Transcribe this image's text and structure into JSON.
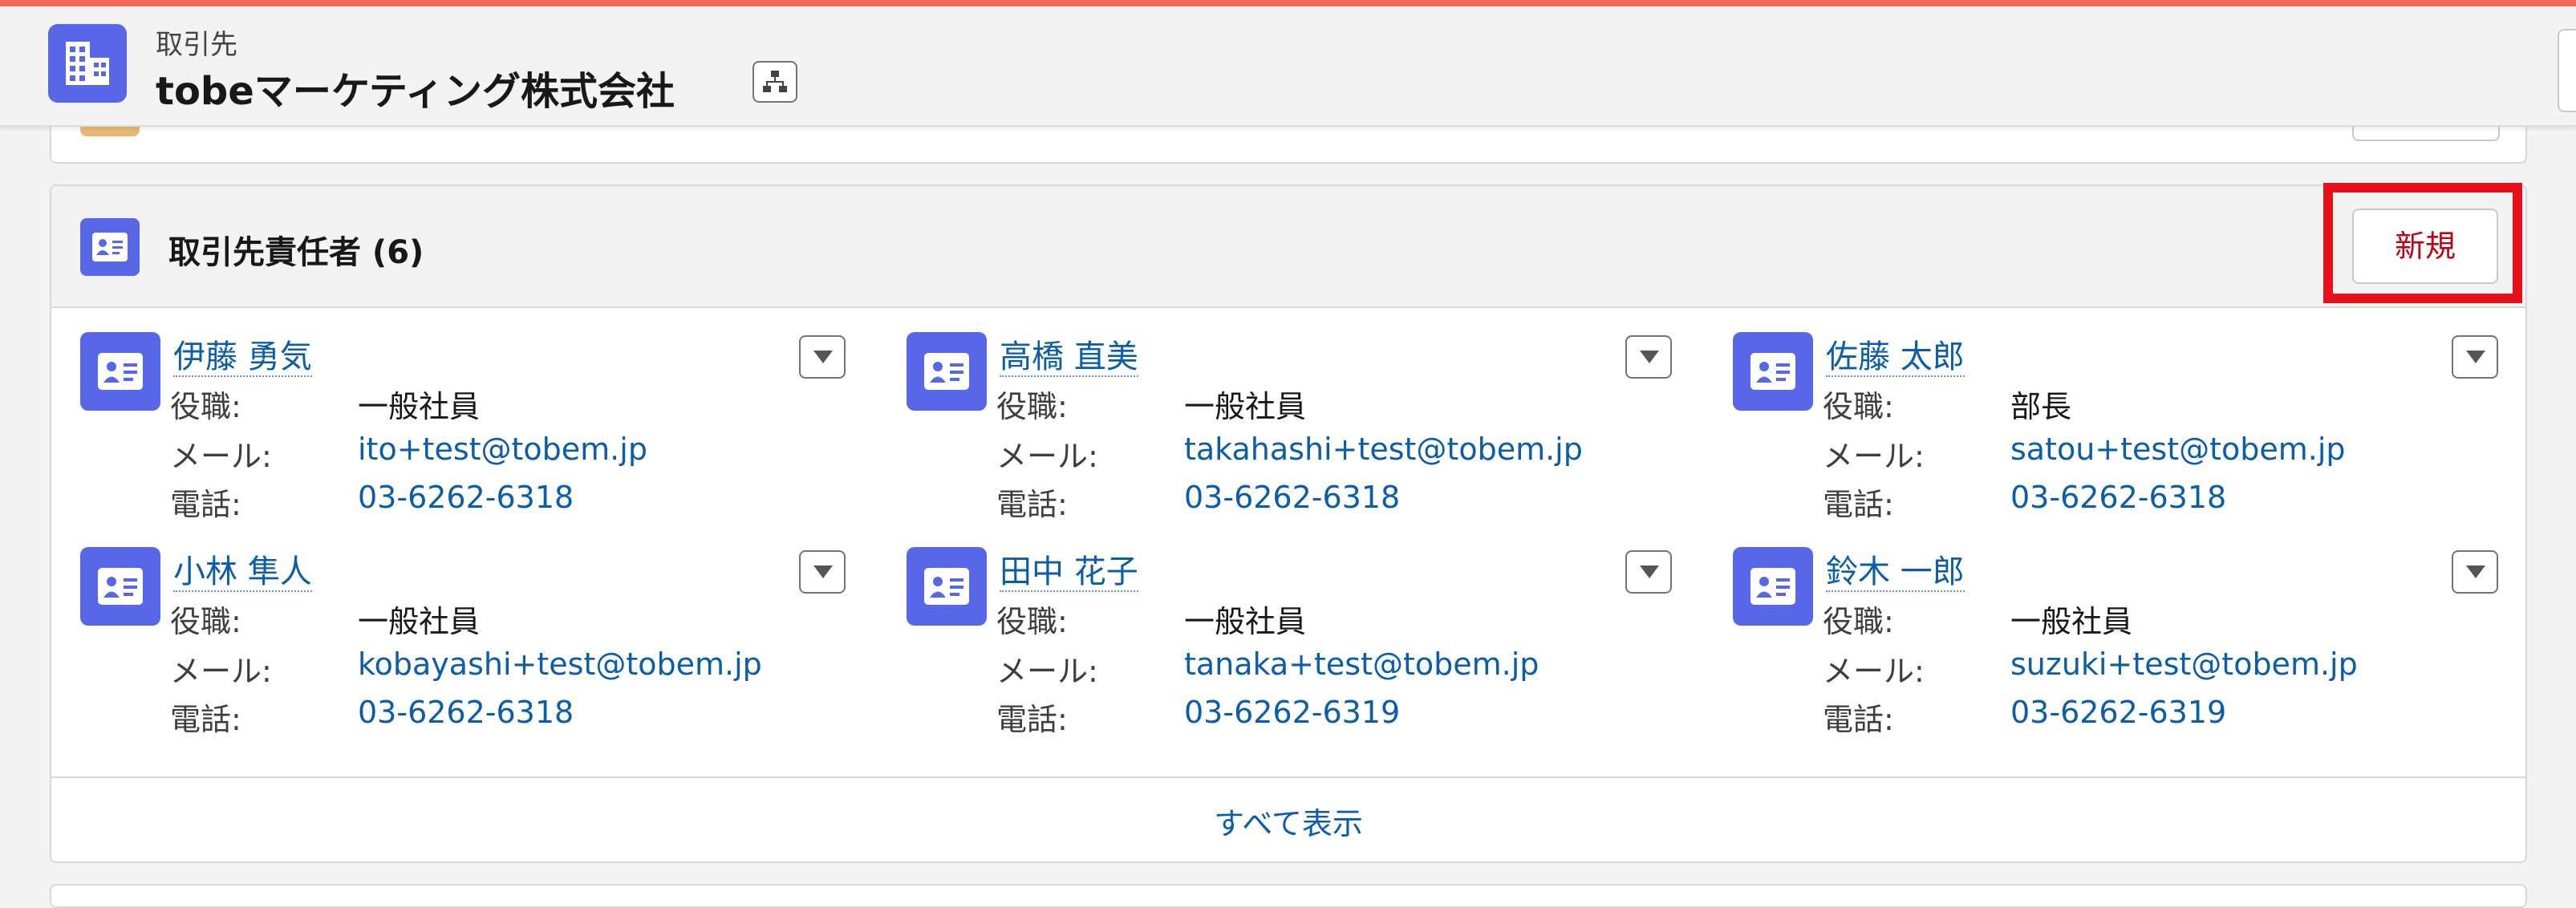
{
  "header": {
    "object_type": "取引先",
    "record_name": "tobeマーケティング株式会社"
  },
  "contacts_card": {
    "title": "取引先責任者 (6)",
    "new_button": "新規",
    "view_all": "すべて表示",
    "labels": {
      "role": "役職:",
      "email": "メール:",
      "phone": "電話:"
    },
    "contacts": [
      {
        "name": "伊藤 勇気",
        "role": "一般社員",
        "email": "ito+test@tobem.jp",
        "phone": "03-6262-6318"
      },
      {
        "name": "高橋 直美",
        "role": "一般社員",
        "email": "takahashi+test@tobem.jp",
        "phone": "03-6262-6318"
      },
      {
        "name": "佐藤 太郎",
        "role": "部長",
        "email": "satou+test@tobem.jp",
        "phone": "03-6262-6318"
      },
      {
        "name": "小林 隼人",
        "role": "一般社員",
        "email": "kobayashi+test@tobem.jp",
        "phone": "03-6262-6318"
      },
      {
        "name": "田中 花子",
        "role": "一般社員",
        "email": "tanaka+test@tobem.jp",
        "phone": "03-6262-6319"
      },
      {
        "name": "鈴木 一郎",
        "role": "一般社員",
        "email": "suzuki+test@tobem.jp",
        "phone": "03-6262-6319"
      }
    ]
  },
  "icons": {
    "header": "building-icon",
    "hierarchy": "hierarchy-icon",
    "card": "contact-card-icon",
    "menu": "chevron-down-icon"
  },
  "colors": {
    "accent": "#5867e8",
    "link": "#0b5cab",
    "highlight": "#e8111b",
    "new_button_text": "#ba0517"
  }
}
